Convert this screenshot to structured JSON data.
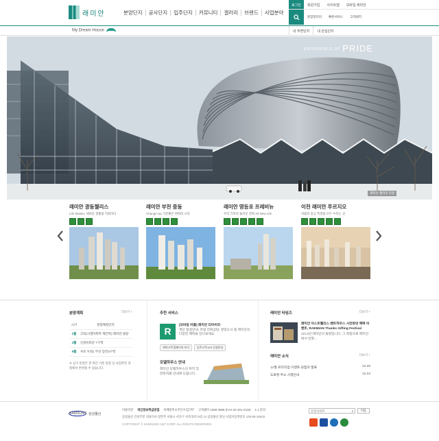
{
  "header": {
    "brand": "래미안",
    "gnb": [
      "분양단지",
      "공사단지",
      "입주단지",
      "커뮤니티",
      "갤러리",
      "브랜드",
      "사업분야"
    ],
    "util_top": [
      "로그인",
      "회원가입",
      "사이트맵",
      "모바일 래미안"
    ],
    "util_bottom": [
      "분양알리미",
      "빠른서비스",
      "고객센터"
    ]
  },
  "subbar": {
    "dream": "My Dream House",
    "tabs": [
      "내 주변단지",
      "내 관심단지"
    ]
  },
  "hero": {
    "tagline_small": "EXPERIENCE OF",
    "tagline_big": "PRIDE",
    "caption": "래미안 갤러리 전경"
  },
  "projects": [
    {
      "title": "래미안 광동첼리스",
      "sub": "Life Master, 새로운 생활을 지휘하다"
    },
    {
      "title": "래미안 부천 중동",
      "sub": "Change Up 기분좋은 변화의 시작"
    },
    {
      "title": "래미안 영등포 프레비뉴",
      "sub": "우리 가족의 놀라운 변화 All New Life"
    },
    {
      "title": "이천 래미안 푸르지오",
      "sub": "서울의 중심 특권을 모두 누리는 곳"
    }
  ],
  "plan": {
    "title": "분양계획",
    "more": "더보기 +",
    "head": [
      "시기",
      "분양예정단지"
    ],
    "rows": [
      {
        "month": "2월",
        "text": "고덕(시영아파트 재건축) 래미안 블랑"
      },
      {
        "month": "4월",
        "text": "신길뉴타운 7구역"
      },
      {
        "month": "9월",
        "text": "서초 우성1 부산 장전3구역"
      }
    ],
    "note": "※ 상기 일정은 현 여건 기준 일정 상 사업추진 과정에서 변경될 수 있습니다."
  },
  "services": {
    "title": "추천 서비스",
    "app_title": "[모바일 어플] 래미안 티아이라",
    "app_desc": "계단 일정안내, 유업 전화상담, 분양소식 등 래미안의 다양한 혜택을 만나보세요.",
    "btn1": "계약고객 홈페이지 보기",
    "btn2": "입주고객 A/S 신청안내",
    "model_title": "모델하우스 안내",
    "model_desc": "래미안 모델하우스의 위치 및 연락처를 안내해 드립니다."
  },
  "times": {
    "title": "래미안 타임즈",
    "more": "더보기 +",
    "headline": "래미안 이스트팰리스 펜트하우스 시전밖앗 해택 이벤트, RAEMIAN Thanks Gifting Festival",
    "desc": "2013년 래미안의 블랑입니다. 그 화일으로 래미안에서 만할..."
  },
  "news": {
    "title": "래미안 소식",
    "more": "더보기 +",
    "items": [
      {
        "text": "12월 프리미엄 이벤트 당첨자 발표",
        "date": "12.26"
      },
      {
        "text": "도로명 주소 시행안내",
        "date": "12.24"
      }
    ]
  },
  "footer": {
    "company_logo": "SAMSUNG",
    "company": "삼성물산",
    "links": [
      "이용약관",
      "개인정보취급방침",
      "이메일주소무단수집거부",
      "고객센터 1588-3588 (FAX 02-401-2119)",
      "1:1 문의"
    ],
    "addr1": "삼성물산 건설부문 대표이사 정연주  서울시 서초구 서초대로74길 14 삼성물산 빌딩  사업자등록번호 135-85-15616",
    "copyright": "COPYRIGHT © SAMSUNG C&T CORP. ALL RIGHTS RESERVED.",
    "family": "유관사이트",
    "go": "이동"
  }
}
